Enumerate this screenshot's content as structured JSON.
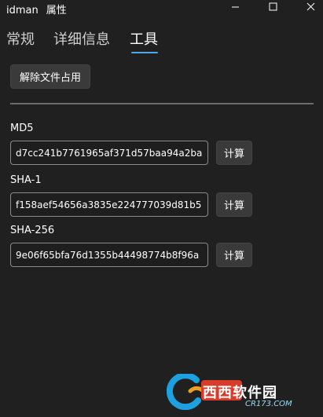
{
  "window": {
    "app_name": "idman",
    "title": "属性",
    "controls": [
      "minimize-icon",
      "maximize-icon",
      "close-icon"
    ]
  },
  "tabs": [
    {
      "label": "常规",
      "selected": false
    },
    {
      "label": "详细信息",
      "selected": false
    },
    {
      "label": "工具",
      "selected": true
    }
  ],
  "tools": {
    "unlock_button": "解除文件占用",
    "hashes": [
      {
        "label": "MD5",
        "value": "d7cc241b7761965af371d57baa94a2ba",
        "button": "计算"
      },
      {
        "label": "SHA-1",
        "value": "f158aef54656a3835e224777039d81b5",
        "button": "计算"
      },
      {
        "label": "SHA-256",
        "value": "9e06f65bfa76d1355b44498774b8f96a",
        "button": "计算"
      }
    ]
  },
  "watermark": {
    "logo_text": "西西软件园",
    "sub_text": "CR173.COM"
  },
  "colors": {
    "background": "#202020",
    "accent": "#4ea7e6",
    "button": "#3a3a3a"
  }
}
